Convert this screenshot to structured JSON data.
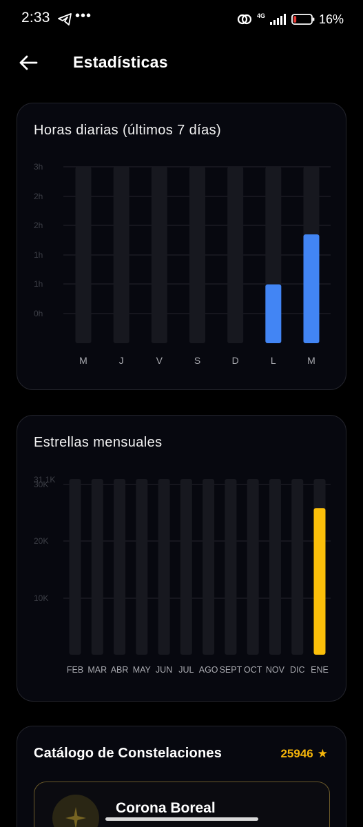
{
  "status_bar": {
    "time": "2:33",
    "dots": "•••",
    "network": "4G",
    "battery_percent": "16%",
    "battery_level": 0.16,
    "battery_color": "#e53935"
  },
  "header": {
    "title": "Estadísticas"
  },
  "daily_chart": {
    "title": "Horas diarias (últimos 7 días)"
  },
  "monthly_chart": {
    "title": "Estrellas mensuales"
  },
  "catalog": {
    "title": "Catálogo de Constelaciones",
    "stars": "25946",
    "star_icon": "★",
    "first_item_name": "Corona Boreal"
  },
  "colors": {
    "accent_blue": "#4285f4",
    "accent_gold": "#fbbf0a",
    "track": "#17181f"
  },
  "chart_data": [
    {
      "type": "bar",
      "title": "Horas diarias (últimos 7 días)",
      "categories": [
        "M",
        "J",
        "V",
        "S",
        "D",
        "L",
        "M"
      ],
      "values": [
        0,
        0,
        0,
        0,
        0,
        1.0,
        1.85
      ],
      "ytick_labels": [
        "3h",
        "2h",
        "2h",
        "1h",
        "1h",
        "0h"
      ],
      "ylim": [
        0,
        3
      ],
      "grid": true
    },
    {
      "type": "bar",
      "title": "Estrellas mensuales",
      "categories": [
        "FEB",
        "MAR",
        "ABR",
        "MAY",
        "JUN",
        "JUL",
        "AGO",
        "SEPT",
        "OCT",
        "NOV",
        "DIC",
        "ENE"
      ],
      "values": [
        0,
        0,
        0,
        0,
        0,
        0,
        0,
        0,
        0,
        0,
        0,
        25946
      ],
      "ytick_labels": [
        "31.1K",
        "30K",
        "20K",
        "10K"
      ],
      "ylim": [
        0,
        31100
      ],
      "grid": true
    }
  ]
}
